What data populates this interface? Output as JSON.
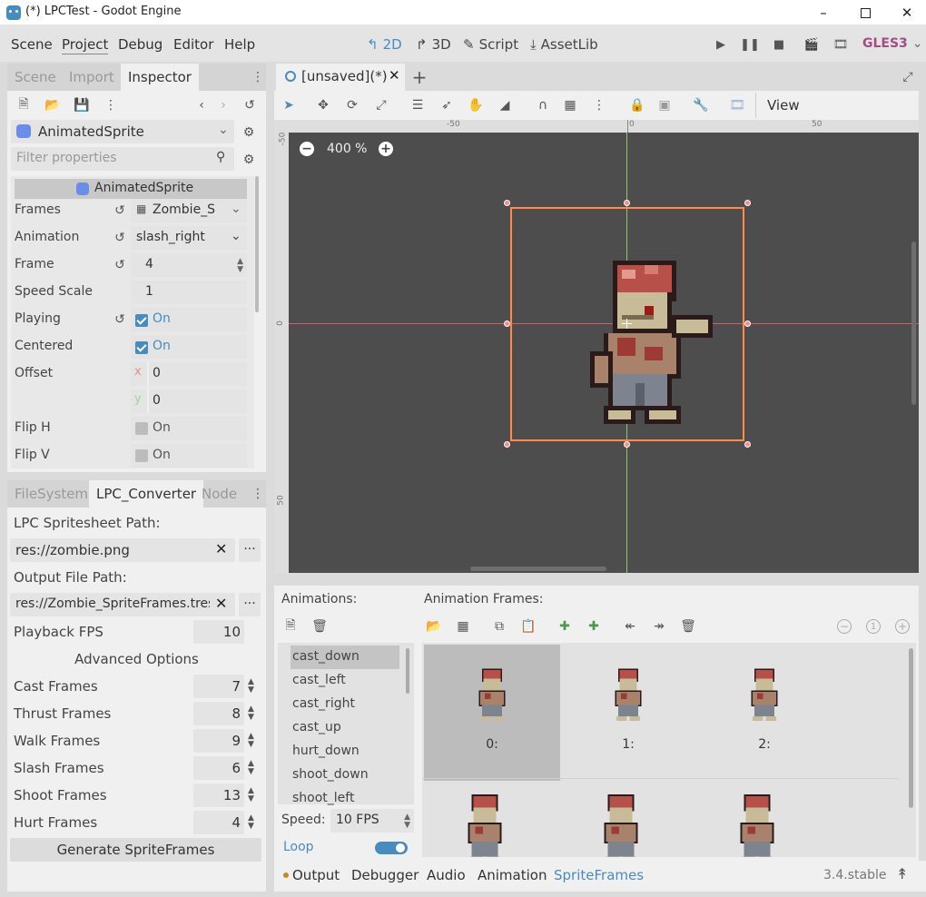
{
  "window": {
    "title": "(*) LPCTest - Godot Engine"
  },
  "menu": {
    "items": [
      "Scene",
      "Project",
      "Debug",
      "Editor",
      "Help"
    ]
  },
  "workspaces": {
    "d2": "2D",
    "d3": "3D",
    "script": "Script",
    "assetlib": "AssetLib"
  },
  "renderer": "GLES3",
  "dock_top": {
    "tabs": [
      "Scene",
      "Import",
      "Inspector"
    ],
    "node_type": "AnimatedSprite",
    "filter_placeholder": "Filter properties",
    "section_title": "AnimatedSprite",
    "props": {
      "frames": {
        "label": "Frames",
        "value": "Zombie_S"
      },
      "animation": {
        "label": "Animation",
        "value": "slash_right"
      },
      "frame": {
        "label": "Frame",
        "value": "4"
      },
      "speed_scale": {
        "label": "Speed Scale",
        "value": "1"
      },
      "playing": {
        "label": "Playing",
        "value": "On"
      },
      "centered": {
        "label": "Centered",
        "value": "On"
      },
      "offset": {
        "label": "Offset",
        "x_label": "x",
        "x": "0",
        "y_label": "y",
        "y": "0"
      },
      "flip_h": {
        "label": "Flip H",
        "value": "On"
      },
      "flip_v": {
        "label": "Flip V",
        "value": "On"
      }
    }
  },
  "dock_bottom": {
    "tabs": [
      "FileSystem",
      "LPC_Converter",
      "Node"
    ],
    "sheet_path_label": "LPC Spritesheet Path:",
    "sheet_path_value": "res://zombie.png",
    "output_path_label": "Output File Path:",
    "output_path_value": "res://Zombie_SpriteFrames.tres",
    "browse": "...",
    "playback_fps": {
      "label": "Playback FPS",
      "value": "10"
    },
    "advanced_options": "Advanced Options",
    "counts": [
      {
        "label": "Cast Frames",
        "value": "7"
      },
      {
        "label": "Thrust Frames",
        "value": "8"
      },
      {
        "label": "Walk Frames",
        "value": "9"
      },
      {
        "label": "Slash Frames",
        "value": "6"
      },
      {
        "label": "Shoot Frames",
        "value": "13"
      },
      {
        "label": "Hurt Frames",
        "value": "4"
      }
    ],
    "generate_button": "Generate SpriteFrames"
  },
  "scene_tab": {
    "label": "[unsaved](*)"
  },
  "toolbar": {
    "view": "View"
  },
  "viewport": {
    "zoom": "400 %",
    "ruler_h": [
      "-50",
      "0",
      "50"
    ],
    "ruler_v": [
      "-50",
      "0",
      "50"
    ]
  },
  "sprite_frames": {
    "animations_label": "Animations:",
    "frames_label": "Animation Frames:",
    "animations": [
      "cast_down",
      "cast_left",
      "cast_right",
      "cast_up",
      "hurt_down",
      "shoot_down",
      "shoot_left"
    ],
    "speed_label": "Speed:",
    "speed_value": "10 FPS",
    "loop_label": "Loop",
    "loop_on": true,
    "frame_labels": [
      "0:",
      "1:",
      "2:"
    ]
  },
  "bottom_tabs": [
    "Output",
    "Debugger",
    "Audio",
    "Animation",
    "SpriteFrames"
  ],
  "version": "3.4.stable",
  "colors": {
    "accent": "#478cbf",
    "selection": "#ff8a4c",
    "gles": "#a04d83"
  }
}
